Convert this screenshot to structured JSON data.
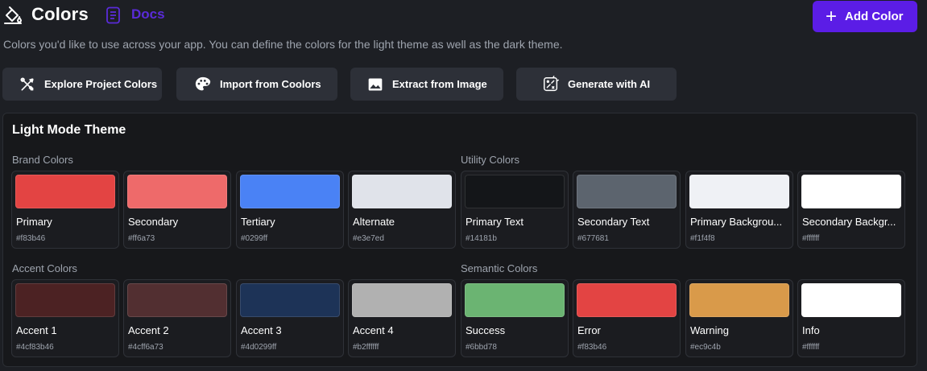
{
  "header": {
    "title": "Colors",
    "docs_label": "Docs",
    "add_label": "Add Color",
    "subtitle": "Colors you'd like to use across your app. You can define the colors for the light theme as well as the dark theme."
  },
  "actions": [
    {
      "label": "Explore Project Colors",
      "icon": "tools-icon"
    },
    {
      "label": "Import from Coolors",
      "icon": "palette-icon"
    },
    {
      "label": "Extract from Image",
      "icon": "image-icon"
    },
    {
      "label": "Generate with AI",
      "icon": "ai-sparkle-icon"
    }
  ],
  "theme": {
    "title": "Light Mode Theme",
    "brand": {
      "label": "Brand Colors",
      "colors": [
        {
          "name": "Primary",
          "hex": "#f83b46",
          "swatch": "#e34443"
        },
        {
          "name": "Secondary",
          "hex": "#ff6a73",
          "swatch": "#ee6a6a"
        },
        {
          "name": "Tertiary",
          "hex": "#0299ff",
          "swatch": "#4a82f5"
        },
        {
          "name": "Alternate",
          "hex": "#e3e7ed",
          "swatch": "#e0e3ea"
        }
      ]
    },
    "utility": {
      "label": "Utility Colors",
      "colors": [
        {
          "name": "Primary Text",
          "hex": "#14181b",
          "swatch": "#141619"
        },
        {
          "name": "Secondary Text",
          "hex": "#677681",
          "swatch": "#5c646e"
        },
        {
          "name": "Primary Backgrou...",
          "hex": "#f1f4f8",
          "swatch": "#eff1f5"
        },
        {
          "name": "Secondary Backgr...",
          "hex": "#ffffff",
          "swatch": "#ffffff"
        }
      ]
    },
    "accent": {
      "label": "Accent Colors",
      "colors": [
        {
          "name": "Accent 1",
          "hex": "#4cf83b46",
          "swatch": "#4c2223"
        },
        {
          "name": "Accent 2",
          "hex": "#4cff6a73",
          "swatch": "#522f31"
        },
        {
          "name": "Accent 3",
          "hex": "#4d0299ff",
          "swatch": "#1d3357"
        },
        {
          "name": "Accent 4",
          "hex": "#b2ffffff",
          "swatch": "#b1b1b1"
        }
      ]
    },
    "semantic": {
      "label": "Semantic Colors",
      "colors": [
        {
          "name": "Success",
          "hex": "#6bbd78",
          "swatch": "#6bb472"
        },
        {
          "name": "Error",
          "hex": "#f83b46",
          "swatch": "#e34443"
        },
        {
          "name": "Warning",
          "hex": "#ec9c4b",
          "swatch": "#d99a4a"
        },
        {
          "name": "Info",
          "hex": "#ffffff",
          "swatch": "#ffffff"
        }
      ]
    }
  },
  "colors": {
    "accent": "#5b1de6",
    "docs": "#5a2bd9",
    "background": "#1d1f24",
    "panel": "#17181b"
  }
}
